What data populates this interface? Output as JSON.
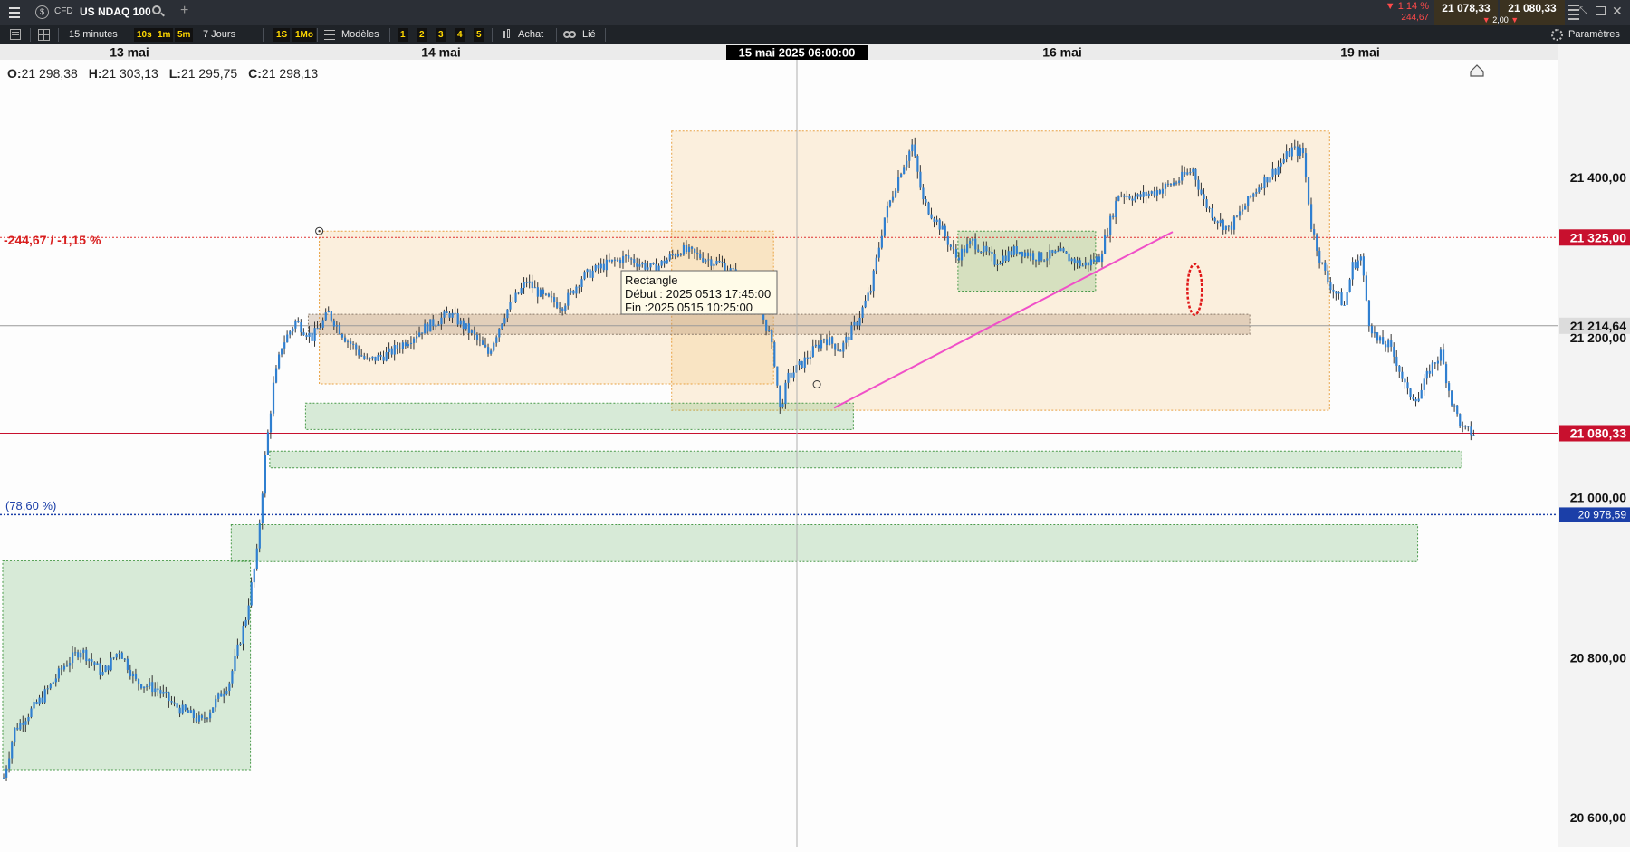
{
  "header": {
    "badge": "CFD",
    "instrument": "US NDAQ 100",
    "add_symbol": "+",
    "change_pct": "▼ 1,14 %",
    "change_abs": "244,67",
    "bid": "21 078,33",
    "ask": "21 080,33",
    "spread": "2,00"
  },
  "toolbar": {
    "interval": "15 minutes",
    "btn_10s": "10s",
    "btn_1m": "1m",
    "btn_5m": "5m",
    "range": "7 Jours",
    "btn_1s": "1S",
    "btn_1mo": "1Mo",
    "models": "Modèles",
    "num_buttons": [
      "1",
      "2",
      "3",
      "4",
      "5"
    ],
    "buy": "Achat",
    "linked": "Lié",
    "settings": "Paramètres"
  },
  "ohlc": {
    "o_label": "O:",
    "o": "21 298,38",
    "h_label": "H:",
    "h": "21 303,13",
    "l_label": "L:",
    "l": "21 295,75",
    "c_label": "C:",
    "c": "21 298,13"
  },
  "crosshair_time": "15 mai 2025 06:00:00",
  "tooltip": {
    "title": "Rectangle",
    "start": "Début : 2025 0513 17:45:00",
    "end": "Fin :2025 0515 10:25:00"
  },
  "annotations": {
    "change_line_label": "-244,67 / -1,15 %",
    "fib_label": "(78,60 %)"
  },
  "colors": {
    "candle": "#2f7fd0",
    "price_tag_red": "#c8102e",
    "fib_blue": "#1b3fa8",
    "orange_zone": "rgba(246,175,76,0.18)",
    "green_zone": "rgba(102,180,102,0.25)",
    "trend_line": "#f050c8"
  },
  "chart_data": {
    "type": "candlestick",
    "x_ticks": [
      {
        "label": "13 mai",
        "date": "2025-05-13"
      },
      {
        "label": "14 mai",
        "date": "2025-05-14"
      },
      {
        "label": "16 mai",
        "date": "2025-05-16"
      },
      {
        "label": "19 mai",
        "date": "2025-05-19"
      }
    ],
    "y_ticks": [
      {
        "label": "21 400,00",
        "value": 21400
      },
      {
        "label": "21 200,00",
        "value": 21200
      },
      {
        "label": "21 000,00",
        "value": 21000
      },
      {
        "label": "20 800,00",
        "value": 20800
      },
      {
        "label": "20 600,00",
        "value": 20600
      }
    ],
    "ylim": [
      20560,
      21450
    ],
    "price_tags": [
      {
        "label": "21 325,00",
        "value": 21325,
        "style": "red"
      },
      {
        "label": "21 214,64",
        "value": 21214.64,
        "style": "gray"
      },
      {
        "label": "21 080,33",
        "value": 21080.33,
        "style": "red"
      },
      {
        "label": "20 978,59",
        "value": 20978.59,
        "style": "blue"
      }
    ],
    "path": [
      [
        0,
        20650
      ],
      [
        4,
        20710
      ],
      [
        14,
        20750
      ],
      [
        22,
        20790
      ],
      [
        28,
        20810
      ],
      [
        36,
        20780
      ],
      [
        42,
        20810
      ],
      [
        48,
        20770
      ],
      [
        56,
        20760
      ],
      [
        62,
        20740
      ],
      [
        72,
        20720
      ],
      [
        82,
        20770
      ],
      [
        88,
        20850
      ],
      [
        92,
        20930
      ],
      [
        95,
        21050
      ],
      [
        98,
        21140
      ],
      [
        101,
        21190
      ],
      [
        106,
        21220
      ],
      [
        112,
        21200
      ],
      [
        118,
        21230
      ],
      [
        124,
        21200
      ],
      [
        132,
        21170
      ],
      [
        140,
        21180
      ],
      [
        152,
        21210
      ],
      [
        162,
        21230
      ],
      [
        170,
        21205
      ],
      [
        176,
        21180
      ],
      [
        182,
        21230
      ],
      [
        190,
        21270
      ],
      [
        196,
        21250
      ],
      [
        203,
        21240
      ],
      [
        210,
        21275
      ],
      [
        218,
        21290
      ],
      [
        226,
        21300
      ],
      [
        236,
        21285
      ],
      [
        246,
        21310
      ],
      [
        254,
        21300
      ],
      [
        262,
        21290
      ],
      [
        268,
        21270
      ],
      [
        273,
        21250
      ],
      [
        278,
        21205
      ],
      [
        280,
        21170
      ],
      [
        282,
        21110
      ],
      [
        285,
        21150
      ],
      [
        292,
        21175
      ],
      [
        298,
        21200
      ],
      [
        304,
        21185
      ],
      [
        310,
        21220
      ],
      [
        315,
        21260
      ],
      [
        320,
        21350
      ],
      [
        326,
        21410
      ],
      [
        330,
        21440
      ],
      [
        334,
        21370
      ],
      [
        340,
        21340
      ],
      [
        346,
        21300
      ],
      [
        352,
        21320
      ],
      [
        360,
        21295
      ],
      [
        368,
        21310
      ],
      [
        376,
        21300
      ],
      [
        384,
        21305
      ],
      [
        392,
        21290
      ],
      [
        398,
        21300
      ],
      [
        405,
        21380
      ],
      [
        412,
        21375
      ],
      [
        420,
        21385
      ],
      [
        426,
        21395
      ],
      [
        432,
        21410
      ],
      [
        436,
        21370
      ],
      [
        440,
        21350
      ],
      [
        445,
        21335
      ],
      [
        450,
        21360
      ],
      [
        456,
        21390
      ],
      [
        462,
        21410
      ],
      [
        468,
        21435
      ],
      [
        472,
        21430
      ],
      [
        475,
        21340
      ],
      [
        478,
        21300
      ],
      [
        481,
        21270
      ],
      [
        484,
        21255
      ],
      [
        487,
        21240
      ],
      [
        490,
        21290
      ],
      [
        493,
        21300
      ],
      [
        496,
        21220
      ],
      [
        499,
        21195
      ],
      [
        503,
        21190
      ],
      [
        506,
        21170
      ],
      [
        510,
        21130
      ],
      [
        514,
        21125
      ],
      [
        518,
        21160
      ],
      [
        522,
        21180
      ],
      [
        526,
        21120
      ],
      [
        530,
        21085
      ],
      [
        534,
        21080
      ]
    ],
    "zones": [
      {
        "kind": "orange",
        "t0": 115,
        "t1": 280,
        "p_top": 21333,
        "p_bot": 21142
      },
      {
        "kind": "orange",
        "t0": 243,
        "t1": 482,
        "p_top": 21458,
        "p_bot": 21109
      },
      {
        "kind": "tan",
        "t0": 111,
        "t1": 453,
        "p_top": 21229,
        "p_bot": 21204
      },
      {
        "kind": "green",
        "t0": 110,
        "t1": 309,
        "p_top": 21118,
        "p_bot": 21085
      },
      {
        "kind": "green",
        "t0": 347,
        "t1": 397,
        "p_top": 21333,
        "p_bot": 21258
      },
      {
        "kind": "green",
        "t0": 97,
        "t1": 530,
        "p_top": 21058,
        "p_bot": 21037
      },
      {
        "kind": "green",
        "t0": 83,
        "t1": 514,
        "p_top": 20966,
        "p_bot": 20920
      },
      {
        "kind": "green",
        "t0": 0,
        "t1": 90,
        "p_top": 20921,
        "p_bot": 20660
      }
    ],
    "trendline": {
      "t0": 302,
      "p0": 21112,
      "t1": 425,
      "p1": 21332
    },
    "marker_ellipse": {
      "t": 433,
      "p": 21260
    }
  }
}
